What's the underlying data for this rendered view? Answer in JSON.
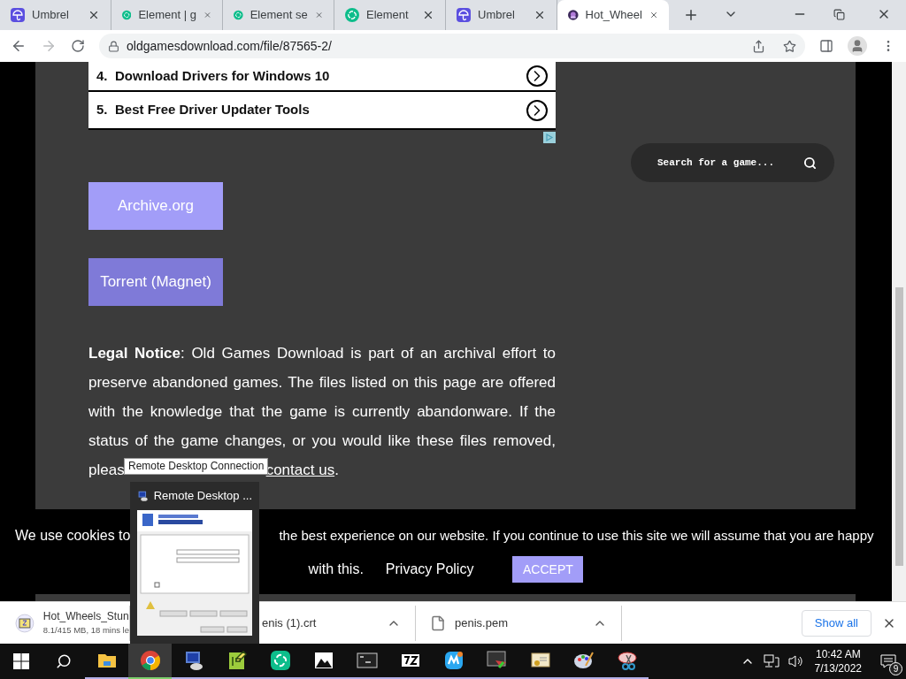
{
  "browser": {
    "tabs": [
      {
        "title": "Umbrel",
        "kind": "umbrel",
        "selected": false
      },
      {
        "title": "Element | g",
        "kind": "element",
        "selected": false
      },
      {
        "title": "Element se",
        "kind": "element",
        "selected": false
      },
      {
        "title": "Element",
        "kind": "element",
        "selected": false
      },
      {
        "title": "Umbrel",
        "kind": "umbrel",
        "selected": false
      },
      {
        "title": "Hot_Wheel",
        "kind": "game",
        "selected": true
      }
    ],
    "address": "oldgamesdownload.com/file/87565-2/"
  },
  "page": {
    "related_links": [
      {
        "number": "4.",
        "text": "Download Drivers for Windows 10"
      },
      {
        "number": "5.",
        "text": "Best Free Driver Updater Tools"
      }
    ],
    "buttons": [
      {
        "label": "Archive.org",
        "color": "#a29df8"
      },
      {
        "label": "Torrent (Magnet)",
        "color": "#7f7ad8"
      }
    ],
    "legal_notice": {
      "label": "Legal Notice",
      "text": ": Old Games Download is part of an archival effort to preserve abandoned games. The files listed on this page are offered with the knowledge that the game is currently abandonware. If the status of the game changes, or you would like these files removed,",
      "cut_text": "pleas",
      "link": "contact us",
      "end": "."
    },
    "search": {
      "placeholder": "Search for a game..."
    }
  },
  "cookie_banner": {
    "text_start": "We use cookies to",
    "text_rest": "the best experience on our website. If you continue to use this site we will assume that you are happy",
    "text_end": "with this.",
    "link": "Privacy Policy",
    "button": "ACCEPT"
  },
  "tooltip": "Remote Desktop Connection",
  "taskbar_preview": {
    "title": "Remote Desktop ..."
  },
  "downloads": [
    {
      "name": "Hot_Wheels_Stun",
      "status": "8.1/415 MB, 18 mins le",
      "kind": "archive"
    },
    {
      "name": "enis (1).crt",
      "kind": "file"
    },
    {
      "name": "penis.pem",
      "kind": "file"
    }
  ],
  "show_all": "Show all",
  "taskbar": {
    "apps": [
      {
        "kind": "explorer",
        "selected": false,
        "running": true
      },
      {
        "kind": "chrome",
        "selected": true,
        "running": true
      },
      {
        "kind": "rdp",
        "selected": false,
        "running": true
      },
      {
        "kind": "notepad",
        "selected": false,
        "running": true
      },
      {
        "kind": "element",
        "selected": false,
        "running": true
      },
      {
        "kind": "photos",
        "selected": false,
        "running": true
      },
      {
        "kind": "terminal",
        "selected": false,
        "running": true
      },
      {
        "kind": "sevenzip",
        "selected": false,
        "running": true
      },
      {
        "kind": "app",
        "selected": false,
        "running": true
      },
      {
        "kind": "devtools",
        "selected": false,
        "running": true
      },
      {
        "kind": "certificate",
        "selected": false,
        "running": true
      },
      {
        "kind": "paint",
        "selected": false,
        "running": true
      },
      {
        "kind": "snip",
        "selected": false,
        "running": true
      }
    ],
    "time": "10:42 AM",
    "date": "7/13/2022",
    "notifications": "9"
  }
}
